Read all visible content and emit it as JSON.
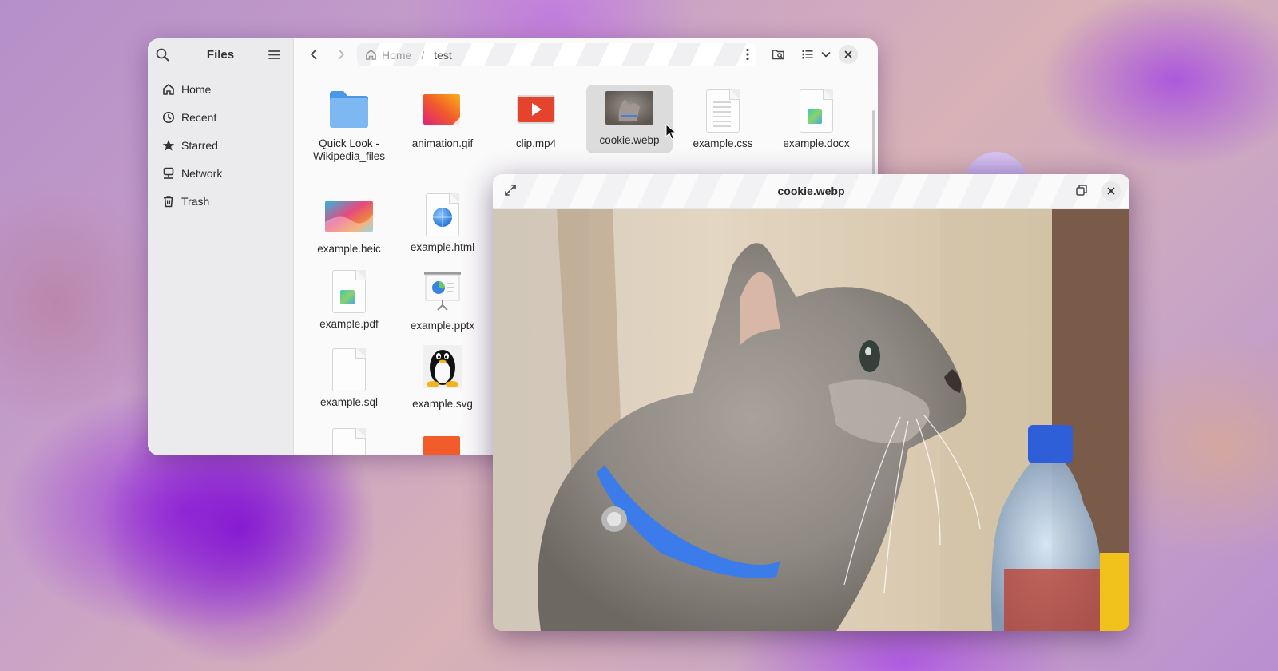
{
  "files_window": {
    "sidebar": {
      "title": "Files",
      "items": [
        {
          "label": "Home",
          "icon": "home-icon"
        },
        {
          "label": "Recent",
          "icon": "clock-icon"
        },
        {
          "label": "Starred",
          "icon": "star-icon"
        },
        {
          "label": "Network",
          "icon": "network-icon"
        },
        {
          "label": "Trash",
          "icon": "trash-icon"
        }
      ]
    },
    "path": {
      "home": "Home",
      "separator": "/",
      "current": "test"
    },
    "files": [
      {
        "name": "Quick Look - Wikipedia_files",
        "icon": "folder-icon"
      },
      {
        "name": "animation.gif",
        "icon": "gif-icon"
      },
      {
        "name": "clip.mp4",
        "icon": "video-icon"
      },
      {
        "name": "cookie.webp",
        "icon": "image-thumbnail",
        "selected": true
      },
      {
        "name": "example.css",
        "icon": "text-document-icon"
      },
      {
        "name": "example.docx",
        "icon": "document-icon"
      },
      {
        "name": "example.heic",
        "icon": "image-icon"
      },
      {
        "name": "example.html",
        "icon": "web-page-icon"
      },
      {
        "name": "example.pdf",
        "icon": "document-icon"
      },
      {
        "name": "example.pptx",
        "icon": "presentation-icon"
      },
      {
        "name": "example.sql",
        "icon": "blank-document-icon"
      },
      {
        "name": "example.svg",
        "icon": "tux-penguin-icon"
      }
    ]
  },
  "viewer": {
    "title": "cookie.webp",
    "image": "kitten with blue collar"
  },
  "colors": {
    "folder": "#5fa8ef",
    "selection": "#dcdcdc",
    "collar": "#3b7bea",
    "video_red": "#e0452d"
  }
}
